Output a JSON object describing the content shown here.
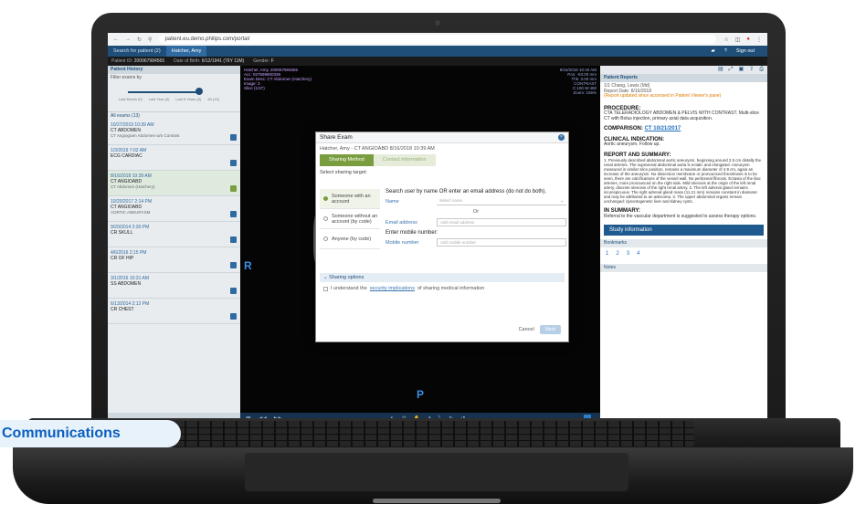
{
  "browser": {
    "url": "patient.eu.demo.philips.com/portal/",
    "nav_icons": [
      "back-icon",
      "forward-icon",
      "reload-icon",
      "site-info-icon"
    ],
    "action_icons": [
      "star-icon",
      "extensions-icon",
      "profile-icon",
      "menu-icon"
    ]
  },
  "app": {
    "tabs": [
      "Search for patient (2)",
      "Hatcher, Amy"
    ],
    "signout": "Sign out",
    "patient_id_label": "Patient ID:",
    "patient_id": "200067984565",
    "dob_label": "Date of Birth:",
    "dob": "6/12/1941 (76Y 11M)",
    "gender_label": "Gender:",
    "gender": "F"
  },
  "history": {
    "title": "Patient History",
    "filter": "Filter exams by",
    "slider_labels": [
      "Last Month",
      "Last Year",
      "Last 5 Years",
      "All"
    ],
    "slider_counts": [
      "(0)",
      "(0)",
      "(0)",
      "(13)"
    ],
    "all_exams": "All exams (13)",
    "exams": [
      {
        "date": "10/27/2019 10:39 AM",
        "title": "CT ABDOMEN",
        "sub": "CT Angiogram Abdomen w/o Contrast"
      },
      {
        "date": "1/3/2019 7:02 AM",
        "title": "ECG CARDIAC",
        "sub": ""
      },
      {
        "date": "8/16/2018 10:39 AM",
        "title": "CT ANGIOABD",
        "sub": "CT Abdomen (Hatchery)"
      },
      {
        "date": "10/20/2017 2:14 PM",
        "title": "CT ANGIOABD",
        "sub": "AORTIC ANEURYSM"
      },
      {
        "date": "9/20/2014 2:30 PM",
        "title": "CR SKULL",
        "sub": ""
      },
      {
        "date": "4/6/2016 2:15 PM",
        "title": "CR OF HIP",
        "sub": ""
      },
      {
        "date": "3/1/2016 10:31 AM",
        "title": "SS ABDOMEN",
        "sub": ""
      },
      {
        "date": "6/13/2014 2:12 PM",
        "title": "CR CHEST",
        "sub": ""
      }
    ]
  },
  "viewer": {
    "overlay_left": [
      "Hatcher, Amy, 200067984565",
      "Acc: 027599800339",
      "Exam Desc: CT Abdomen (Hatchery)",
      "Image: 3",
      "Slice (1/37)"
    ],
    "overlay_right": [
      "8/16/2018 10:40 AM",
      "Pos: -93.00 mm",
      "Thk: 3.00 mm",
      "CONTRAST",
      "C:100 W:450",
      "Zoom: 156%"
    ],
    "marker_r": "R",
    "marker_p": "P"
  },
  "modal": {
    "title": "Share Exam",
    "subtitle": "Hatcher, Amy - CT ANGIOABD 8/16/2018 10:39 AM",
    "step1": "Sharing Method",
    "step2": "Contact information",
    "target": "Select sharing target:",
    "options": [
      "Someone with an account",
      "Someone without an account (by code)",
      "Anyone (by code)"
    ],
    "search_head": "Search user by name OR enter an email address (do not do both).",
    "name_label": "Name",
    "name_placeholder": "Select name",
    "or": "Or",
    "email_label": "Email address",
    "email_placeholder": "Add email address",
    "mobile_head": "Enter mobile number:",
    "mobile_label": "Mobile number",
    "mobile_placeholder": "Add mobile number",
    "sharing_options": "Sharing options",
    "consent_prefix": "I understand the",
    "consent_link": "security implications",
    "consent_suffix": "of sharing medical information",
    "cancel": "Cancel",
    "next": "Next"
  },
  "report": {
    "title": "Patient Reports",
    "meta1": "1/1 Chang, Lewis (Md)",
    "meta2": "Report Date: 8/16/2018",
    "warn": "(Report updated since accessed in Patient Viewer's pane)",
    "procedure_h": "PROCEDURE:",
    "procedure": "CTA TELERADIOLOGY ABDOMEN & PELVIS WITH CONTRAST. Multi-slice CT with Bolus injection, primary axial data acquisition.",
    "comparison_h": "COMPARISON:",
    "comparison_link": "CT 10/21/2017",
    "clinical_h": "CLINICAL INDICATION:",
    "clinical": "Aortic aneurysm. Follow up.",
    "report_h": "REPORT AND SUMMARY:",
    "report_body": "1. Previously described abdominal aortic aneurysm, beginning around 2.5 cm distally the renal arteries. The suprarenal abdominal aorta is ectatic and elongated. Aneurysm measured in similar slice position, remains a maximum diameter of 4.9 cm, again an increase of the aneurysm. No dissection membrane or pronounced thrombosis is to be seen, there are calcifications of the vessel wall. No peritoneal fibrosis. Ectasia of the iliac arteries, more pronounced on the right side. Mild stenosis at the origin of the left renal artery, discrete stenosis of the right renal artery. 2. The left adrenal gland remains inconspicuous. The right adrenal gland mass (11.21 mm) remains constant in diameter and may be attributed to an adenoma. 3. The upper abdominal organs remain unchanged: dysontogenetic liver and kidney cysts.",
    "summary_h": "IN SUMMARY:",
    "summary": "Referral to the vascular department is suggested to assess therapy options.",
    "study_info": "Study information",
    "bookmarks": "Bookmarks",
    "bookmark_nums": [
      "1",
      "2",
      "3",
      "4"
    ],
    "notes": "Notes"
  },
  "badge": "Communications"
}
